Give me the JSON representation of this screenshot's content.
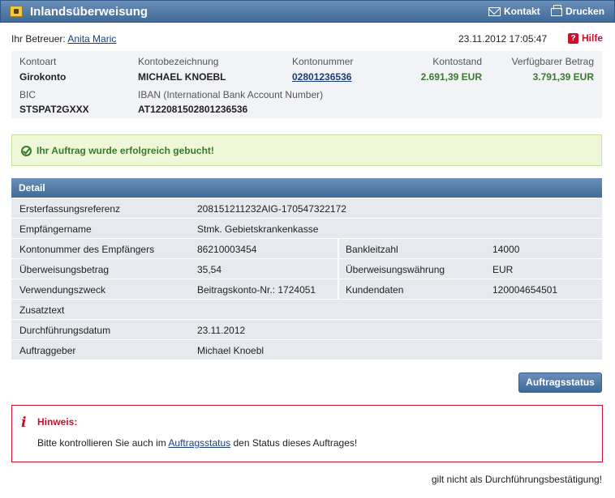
{
  "header": {
    "title": "Inlandsüberweisung",
    "kontakt": "Kontakt",
    "drucken": "Drucken"
  },
  "meta": {
    "betreuer_label": "Ihr Betreuer:",
    "betreuer_name": "Anita Maric",
    "datetime": "23.11.2012 17:05:47",
    "hilfe": "Hilfe"
  },
  "account": {
    "kontoart_label": "Kontoart",
    "kontoart": "Girokonto",
    "bezeichnung_label": "Kontobezeichnung",
    "bezeichnung": "MICHAEL KNOEBL",
    "nummer_label": "Kontonummer",
    "nummer": "02801236536",
    "stand_label": "Kontostand",
    "stand": "2.691,39 EUR",
    "verfuegbar_label": "Verfügbarer Betrag",
    "verfuegbar": "3.791,39 EUR",
    "bic_label": "BIC",
    "bic": "STSPAT2GXXX",
    "iban_label": "IBAN (International Bank Account Number)",
    "iban": "AT122081502801236536"
  },
  "success": {
    "message": "Ihr Auftrag wurde erfolgreich gebucht!"
  },
  "detail": {
    "title": "Detail",
    "rows": [
      {
        "l1": "Ersterfassungsreferenz",
        "v1": "208151211232AIG-170547322172",
        "l2": "",
        "v2": ""
      },
      {
        "l1": "Empfängername",
        "v1": "Stmk. Gebietskrankenkasse",
        "l2": "",
        "v2": ""
      },
      {
        "l1": "Kontonummer des Empfängers",
        "v1": "86210003454",
        "l2": "Bankleitzahl",
        "v2": "14000"
      },
      {
        "l1": "Überweisungsbetrag",
        "v1": "35,54",
        "l2": "Überweisungswährung",
        "v2": "EUR"
      },
      {
        "l1": "Verwendungszweck",
        "v1": "Beitragskonto-Nr.: 1724051",
        "l2": "Kundendaten",
        "v2": "120004654501"
      },
      {
        "l1": "Zusatztext",
        "v1": "",
        "l2": "",
        "v2": ""
      },
      {
        "l1": "Durchführungsdatum",
        "v1": "23.11.2012",
        "l2": "",
        "v2": ""
      },
      {
        "l1": "Auftraggeber",
        "v1": "Michael Knoebl",
        "l2": "",
        "v2": ""
      }
    ]
  },
  "actions": {
    "auftragsstatus": "Auftragsstatus"
  },
  "hinweis": {
    "title": "Hinweis:",
    "text_before": "Bitte kontrollieren Sie auch im ",
    "link": "Auftragsstatus",
    "text_after": " den Status dieses Auftrages!"
  },
  "footnote": "gilt nicht als Durchführungsbestätigung!"
}
